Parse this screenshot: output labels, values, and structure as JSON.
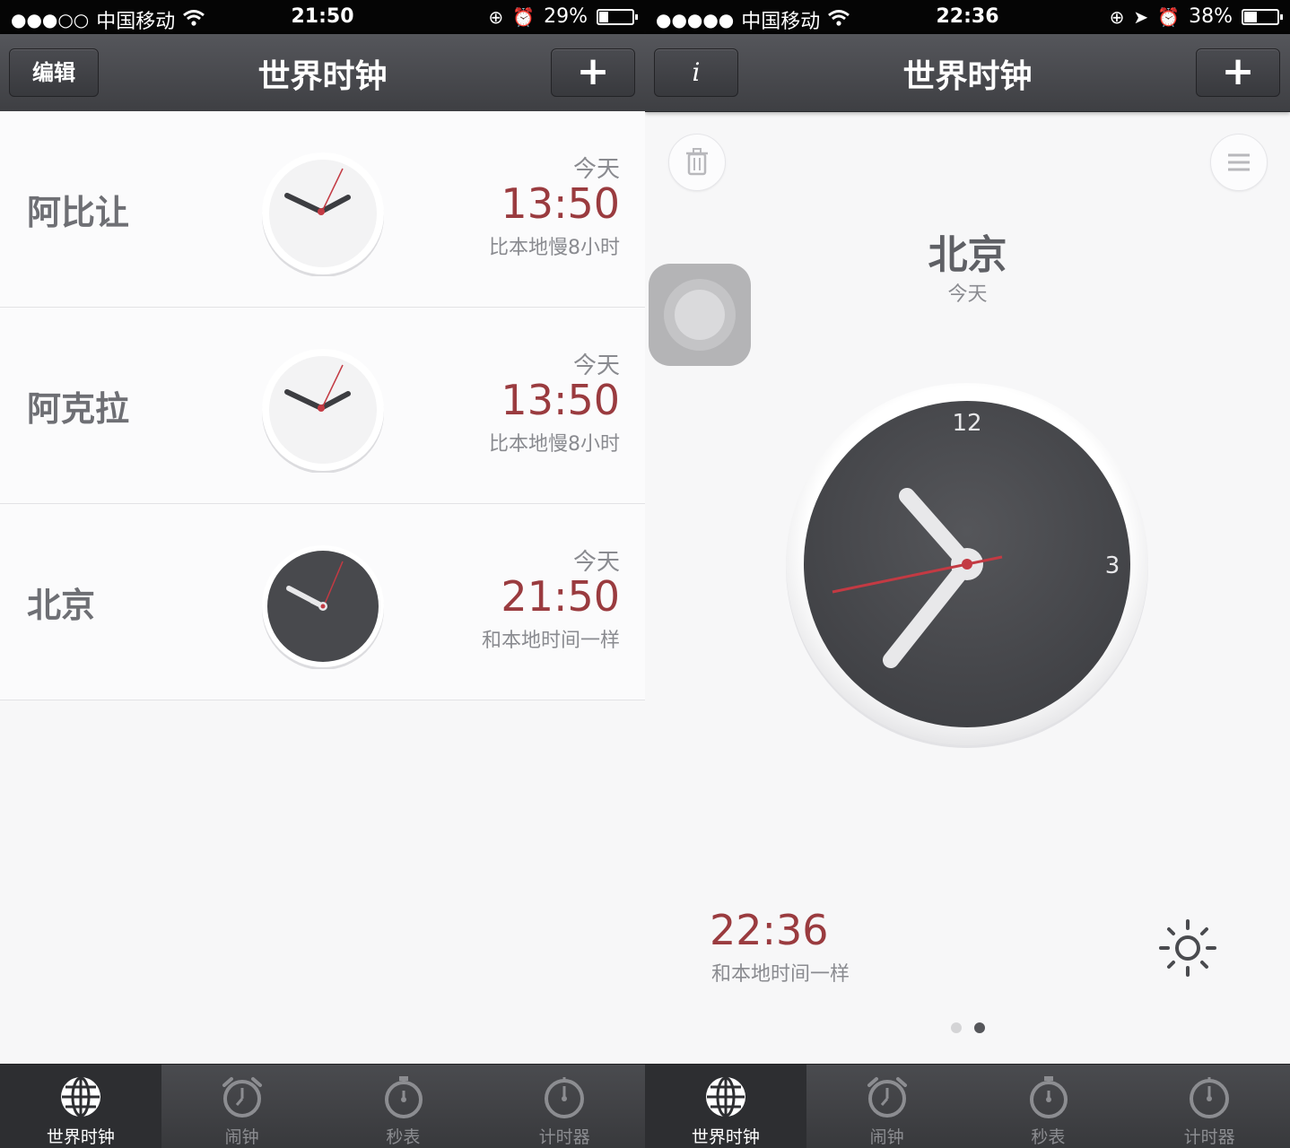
{
  "left_screen": {
    "status": {
      "carrier": "中国移动",
      "time": "21:50",
      "battery": "29%",
      "battery_level": 0.29
    },
    "nav": {
      "left_button": "编辑",
      "title": "世界时钟",
      "add_button": "+"
    },
    "cities": [
      {
        "name": "阿比让",
        "day": "今天",
        "time": "13:50",
        "diff": "比本地慢8小时",
        "face": "light"
      },
      {
        "name": "阿克拉",
        "day": "今天",
        "time": "13:50",
        "diff": "比本地慢8小时",
        "face": "light"
      },
      {
        "name": "北京",
        "day": "今天",
        "time": "21:50",
        "diff": "和本地时间一样",
        "face": "dark"
      }
    ],
    "tabs": [
      {
        "label": "世界时钟",
        "icon": "globe-icon",
        "active": true
      },
      {
        "label": "闹钟",
        "icon": "alarm-clock-icon",
        "active": false
      },
      {
        "label": "秒表",
        "icon": "stopwatch-icon",
        "active": false
      },
      {
        "label": "计时器",
        "icon": "timer-icon",
        "active": false
      }
    ]
  },
  "right_screen": {
    "status": {
      "carrier": "中国移动",
      "time": "22:36",
      "battery": "38%",
      "battery_level": 0.38
    },
    "nav": {
      "info_button": "i",
      "title": "世界时钟",
      "add_button": "+"
    },
    "detail": {
      "city": "北京",
      "day": "今天",
      "dial_labels": {
        "twelve": "12",
        "three": "3"
      },
      "time": "22:36",
      "diff": "和本地时间一样",
      "page_count": 2,
      "current_page": 2
    },
    "tabs": [
      {
        "label": "世界时钟",
        "icon": "globe-icon",
        "active": true
      },
      {
        "label": "闹钟",
        "icon": "alarm-clock-icon",
        "active": false
      },
      {
        "label": "秒表",
        "icon": "stopwatch-icon",
        "active": false
      },
      {
        "label": "计时器",
        "icon": "timer-icon",
        "active": false
      }
    ]
  },
  "colors": {
    "accent_red": "#9a3b3f",
    "navbar": "#46474b",
    "background": "#f7f7f8"
  }
}
